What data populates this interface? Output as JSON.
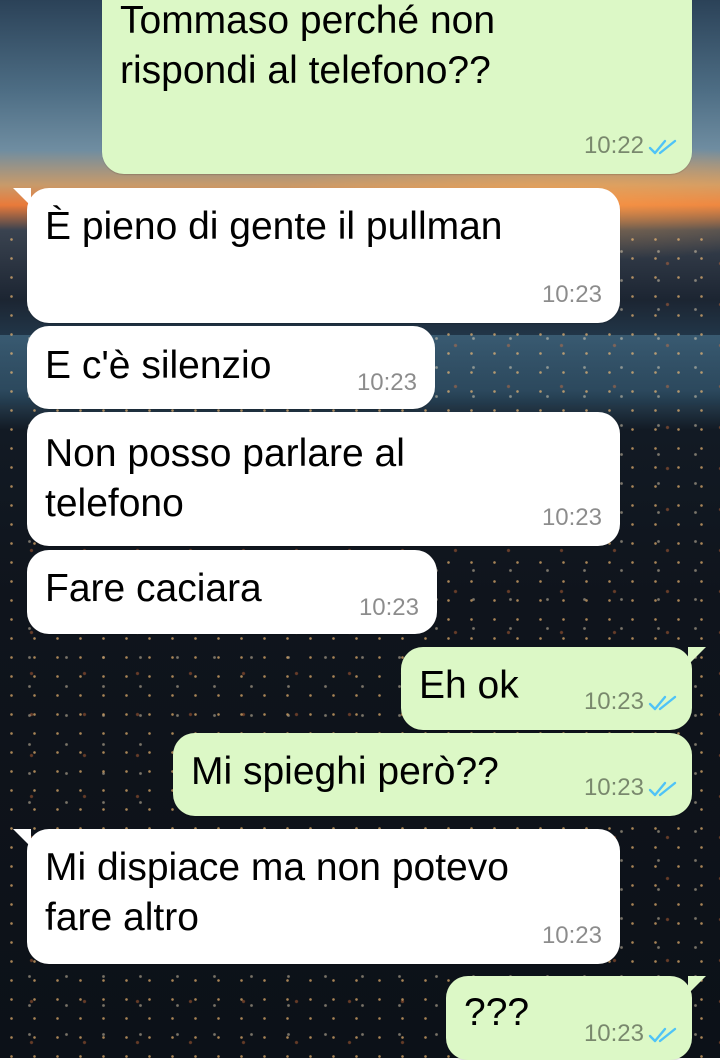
{
  "conversation": {
    "messages": [
      {
        "direction": "out",
        "text": "Tommaso perché non\nrispondi al telefono??",
        "time": "10:22",
        "status": "read"
      },
      {
        "direction": "in",
        "text": "È pieno di gente il pullman",
        "time": "10:23"
      },
      {
        "direction": "in",
        "text": "E c'è silenzio",
        "time": "10:23"
      },
      {
        "direction": "in",
        "text": "Non posso parlare al\ntelefono",
        "time": "10:23"
      },
      {
        "direction": "in",
        "text": "Fare caciara",
        "time": "10:23"
      },
      {
        "direction": "out",
        "text": "Eh ok",
        "time": "10:23",
        "status": "read"
      },
      {
        "direction": "out",
        "text": "Mi spieghi però??",
        "time": "10:23",
        "status": "read"
      },
      {
        "direction": "in",
        "text": "Mi dispiace ma non potevo\nfare altro",
        "time": "10:23"
      },
      {
        "direction": "out",
        "text": "???",
        "time": "10:23",
        "status": "read"
      }
    ]
  },
  "colors": {
    "incoming_bubble": "#ffffff",
    "outgoing_bubble": "#dcf8c6",
    "read_ticks": "#4fc3f7",
    "timestamp": "#7a7a7a"
  },
  "icons": {
    "read_status": "double-check-icon"
  }
}
